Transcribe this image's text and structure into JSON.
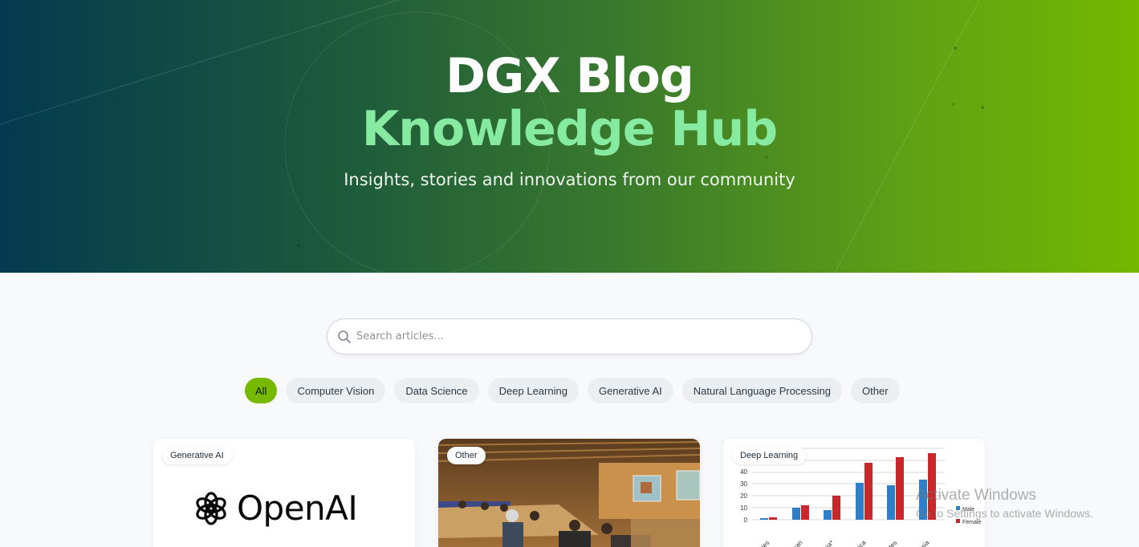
{
  "hero": {
    "title": "DGX Blog",
    "subtitle": "Knowledge Hub",
    "tagline": "Insights, stories and innovations from our community"
  },
  "search": {
    "placeholder": "Search articles...",
    "icon": "search-icon"
  },
  "filters": [
    {
      "label": "All",
      "active": true
    },
    {
      "label": "Computer Vision",
      "active": false
    },
    {
      "label": "Data Science",
      "active": false
    },
    {
      "label": "Deep Learning",
      "active": false
    },
    {
      "label": "Generative AI",
      "active": false
    },
    {
      "label": "Natural Language Processing",
      "active": false
    },
    {
      "label": "Other",
      "active": false
    }
  ],
  "cards": [
    {
      "category": "Generative AI",
      "image": "openai-logo",
      "logo_text": "OpenAI"
    },
    {
      "category": "Other",
      "image": "lecture-hall-photo"
    },
    {
      "category": "Deep Learning",
      "image": "bar-chart-image",
      "chart_axis": [
        "40",
        "30",
        "20",
        "10",
        "0"
      ],
      "chart_categories": [
        "Countries",
        "Caribbean",
        "Oceania*",
        "n Africa",
        "ab States",
        "uth Asia"
      ],
      "legend": [
        "Male",
        "Female"
      ]
    }
  ],
  "colors": {
    "accent": "#76b900",
    "hero_subtitle": "#86eaa1"
  },
  "watermark": {
    "line1": "Activate Windows",
    "line2": "Go to Settings to activate Windows."
  }
}
